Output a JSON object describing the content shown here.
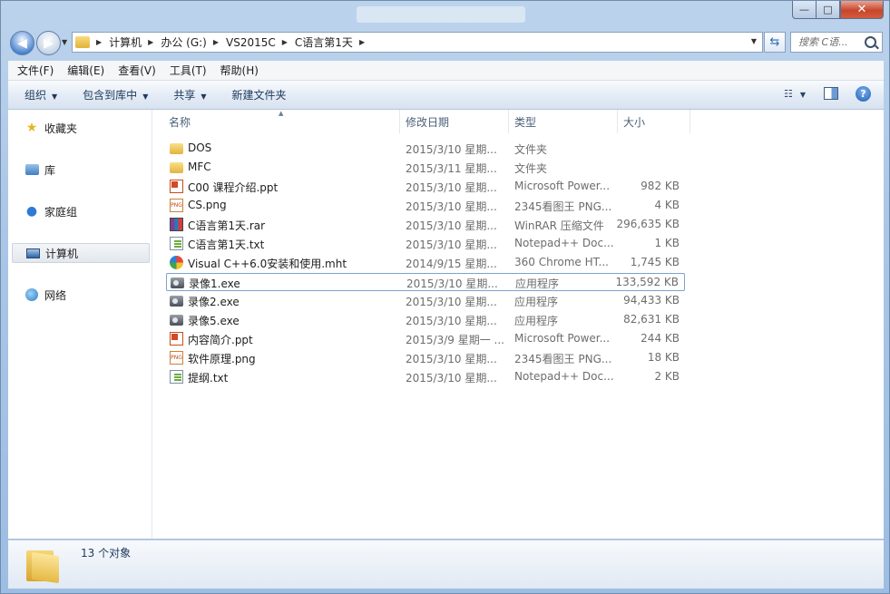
{
  "window": {
    "controls": {
      "minimize": "—",
      "maximize": "□",
      "close": "✕"
    }
  },
  "address": {
    "crumbs": [
      "计算机",
      "办公 (G:)",
      "VS2015C",
      "C语言第1天"
    ]
  },
  "search": {
    "placeholder": "搜索 C语..."
  },
  "menu": [
    "文件(F)",
    "编辑(E)",
    "查看(V)",
    "工具(T)",
    "帮助(H)"
  ],
  "toolbar": {
    "organize": "组织",
    "include_library": "包含到库中",
    "share": "共享",
    "new_folder": "新建文件夹",
    "help": "?"
  },
  "nav": {
    "favorites": "收藏夹",
    "libraries": "库",
    "homegroup": "家庭组",
    "computer": "计算机",
    "network": "网络"
  },
  "columns": {
    "name": "名称",
    "date": "修改日期",
    "type": "类型",
    "size": "大小"
  },
  "files": [
    {
      "name": "DOS",
      "date": "2015/3/10 星期...",
      "type": "文件夹",
      "size": "",
      "icon": "folder-icon"
    },
    {
      "name": "MFC",
      "date": "2015/3/11 星期...",
      "type": "文件夹",
      "size": "",
      "icon": "folder-icon"
    },
    {
      "name": "C00 课程介绍.ppt",
      "date": "2015/3/10 星期...",
      "type": "Microsoft Power...",
      "size": "982 KB",
      "icon": "ppt-icon"
    },
    {
      "name": "CS.png",
      "date": "2015/3/10 星期...",
      "type": "2345看图王 PNG...",
      "size": "4 KB",
      "icon": "png-icon"
    },
    {
      "name": "C语言第1天.rar",
      "date": "2015/3/10 星期...",
      "type": "WinRAR 压缩文件",
      "size": "296,635 KB",
      "icon": "rar-icon"
    },
    {
      "name": "C语言第1天.txt",
      "date": "2015/3/10 星期...",
      "type": "Notepad++ Doc...",
      "size": "1 KB",
      "icon": "txt-icon"
    },
    {
      "name": "Visual C++6.0安装和使用.mht",
      "date": "2014/9/15 星期...",
      "type": "360 Chrome HT...",
      "size": "1,745 KB",
      "icon": "mht-icon"
    },
    {
      "name": "录像1.exe",
      "date": "2015/3/10 星期...",
      "type": "应用程序",
      "size": "133,592 KB",
      "icon": "exe-icon"
    },
    {
      "name": "录像2.exe",
      "date": "2015/3/10 星期...",
      "type": "应用程序",
      "size": "94,433 KB",
      "icon": "exe-icon"
    },
    {
      "name": "录像5.exe",
      "date": "2015/3/10 星期...",
      "type": "应用程序",
      "size": "82,631 KB",
      "icon": "exe-icon"
    },
    {
      "name": "内容简介.ppt",
      "date": "2015/3/9 星期一 ...",
      "type": "Microsoft Power...",
      "size": "244 KB",
      "icon": "ppt-icon"
    },
    {
      "name": "软件原理.png",
      "date": "2015/3/10 星期...",
      "type": "2345看图王 PNG...",
      "size": "18 KB",
      "icon": "png-icon"
    },
    {
      "name": "提纲.txt",
      "date": "2015/3/10 星期...",
      "type": "Notepad++ Doc...",
      "size": "2 KB",
      "icon": "txt-icon"
    }
  ],
  "selected_index": 7,
  "details": {
    "count": "13 个对象"
  }
}
